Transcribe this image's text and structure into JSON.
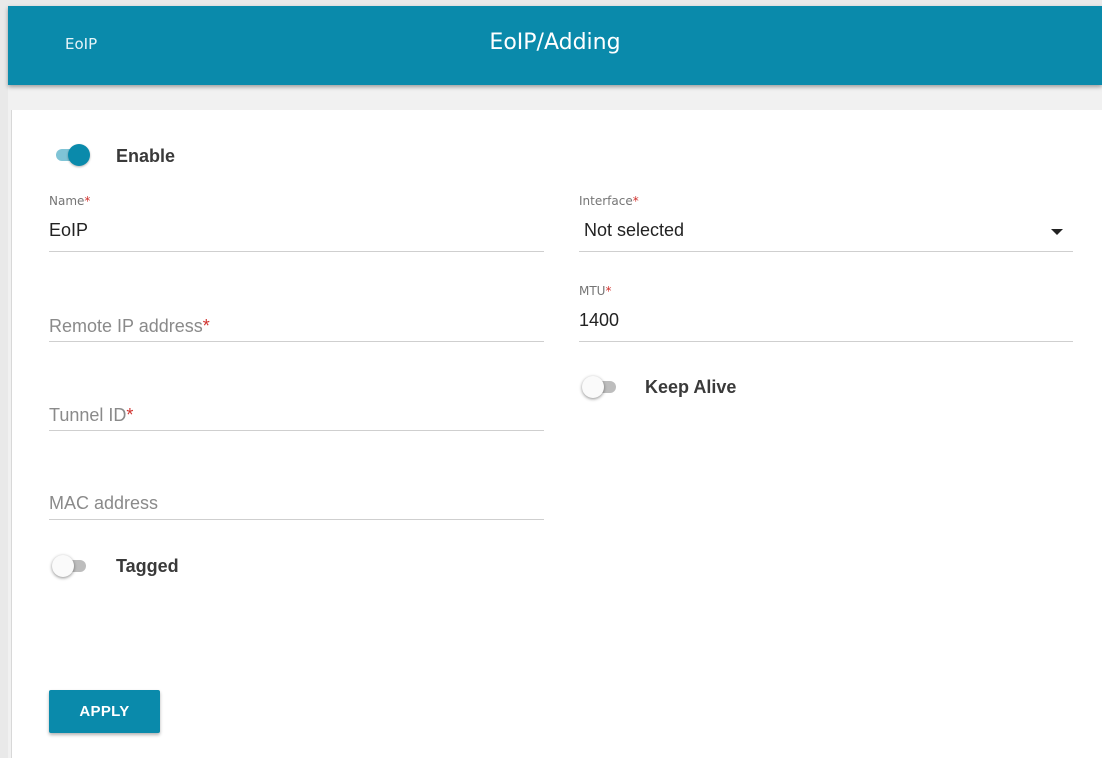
{
  "header": {
    "back_label": "EoIP",
    "title": "EoIP/Adding",
    "accent_color": "#0a8aab"
  },
  "form": {
    "enable": {
      "label": "Enable",
      "checked": true
    },
    "name": {
      "label": "Name",
      "required_mark": "*",
      "value": "EoIP"
    },
    "interface": {
      "label": "Interface",
      "required_mark": "*",
      "value": "Not selected"
    },
    "remote_ip": {
      "placeholder": "Remote IP address",
      "required_mark": "*"
    },
    "mtu": {
      "label": "MTU",
      "required_mark": "*",
      "value": "1400"
    },
    "keep_alive": {
      "label": "Keep Alive",
      "checked": false
    },
    "tunnel_id": {
      "placeholder": "Tunnel ID",
      "required_mark": "*"
    },
    "mac_address": {
      "placeholder": "MAC address"
    },
    "tagged": {
      "label": "Tagged",
      "checked": false
    },
    "apply_label": "APPLY"
  }
}
